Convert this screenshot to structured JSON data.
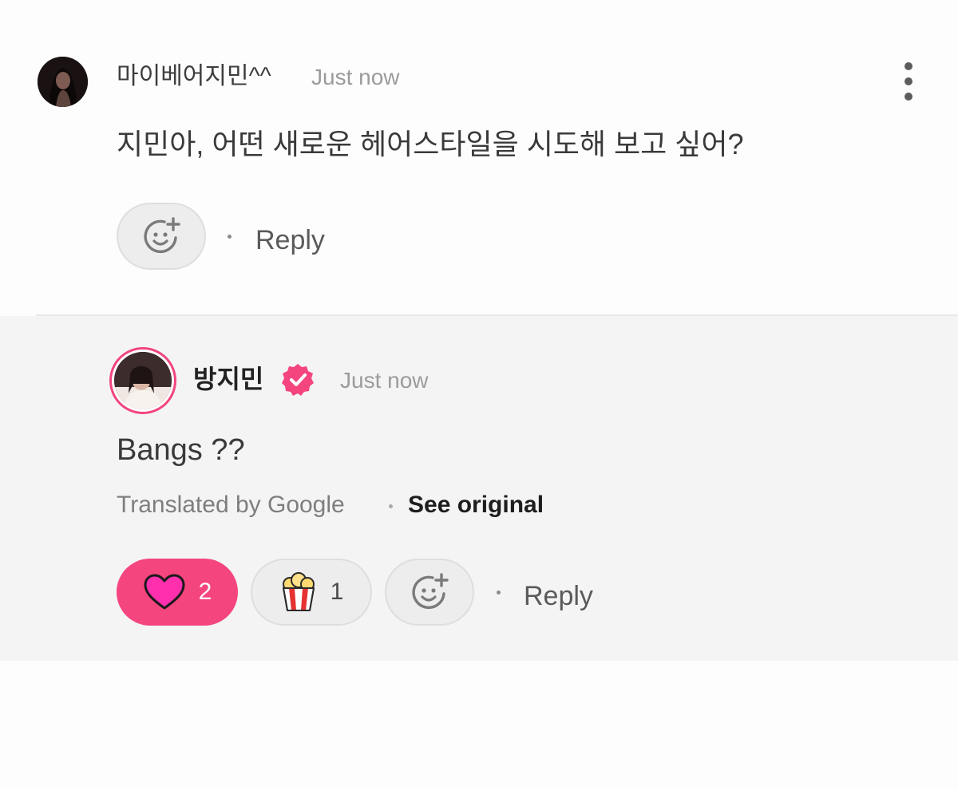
{
  "comment": {
    "author": "마이베어지민^^",
    "timestamp": "Just now",
    "body": "지민아, 어떤 새로운 헤어스타일을 시도해 보고 싶어?",
    "reply_label": "Reply",
    "icons": {
      "avatar": "user-avatar",
      "more": "vertical-dots-icon",
      "add_reaction": "add-reaction-smiley-icon"
    }
  },
  "reply": {
    "author": "방지민",
    "verified": true,
    "timestamp": "Just now",
    "body": "Bangs ??",
    "translated_label": "Translated by Google",
    "see_original_label": "See original",
    "reactions": [
      {
        "icon": "heart-icon",
        "count": "2",
        "active": true
      },
      {
        "icon": "popcorn-icon",
        "count": "1",
        "active": false
      }
    ],
    "reply_label": "Reply",
    "icons": {
      "avatar": "artist-avatar",
      "verified": "verified-badge-icon",
      "add_reaction": "add-reaction-smiley-icon"
    }
  },
  "colors": {
    "accent_pink": "#f4457f",
    "reply_background": "#f4f4f4",
    "pill_grey": "#ededed",
    "muted_text": "#9b9b9b"
  }
}
